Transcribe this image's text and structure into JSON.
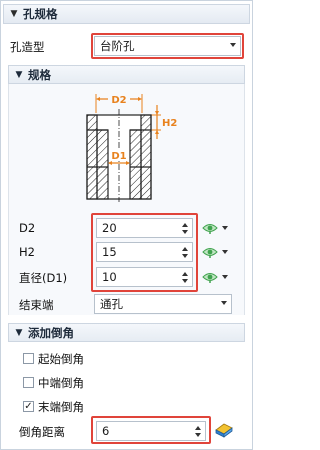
{
  "hole_spec": {
    "header": "孔规格",
    "hole_type_label": "孔造型",
    "hole_type_value": "台阶孔"
  },
  "spec": {
    "header": "规格",
    "diagram_labels": {
      "d2": "D2",
      "h2": "H2",
      "d1": "D1"
    }
  },
  "params": [
    {
      "label": "D2",
      "value": "20"
    },
    {
      "label": "H2",
      "value": "15"
    },
    {
      "label": "直径(D1)",
      "value": "10"
    }
  ],
  "end_condition": {
    "label": "结束端",
    "value": "通孔"
  },
  "chamfer": {
    "header": "添加倒角",
    "options": [
      {
        "label": "起始倒角",
        "checked": false
      },
      {
        "label": "中端倒角",
        "checked": false
      },
      {
        "label": "末端倒角",
        "checked": true
      }
    ],
    "distance_label": "倒角距离",
    "distance_value": "6"
  },
  "colors": {
    "highlight": "#e0443a",
    "dim_orange": "#e8821e",
    "eye_green": "#3fa34d"
  }
}
